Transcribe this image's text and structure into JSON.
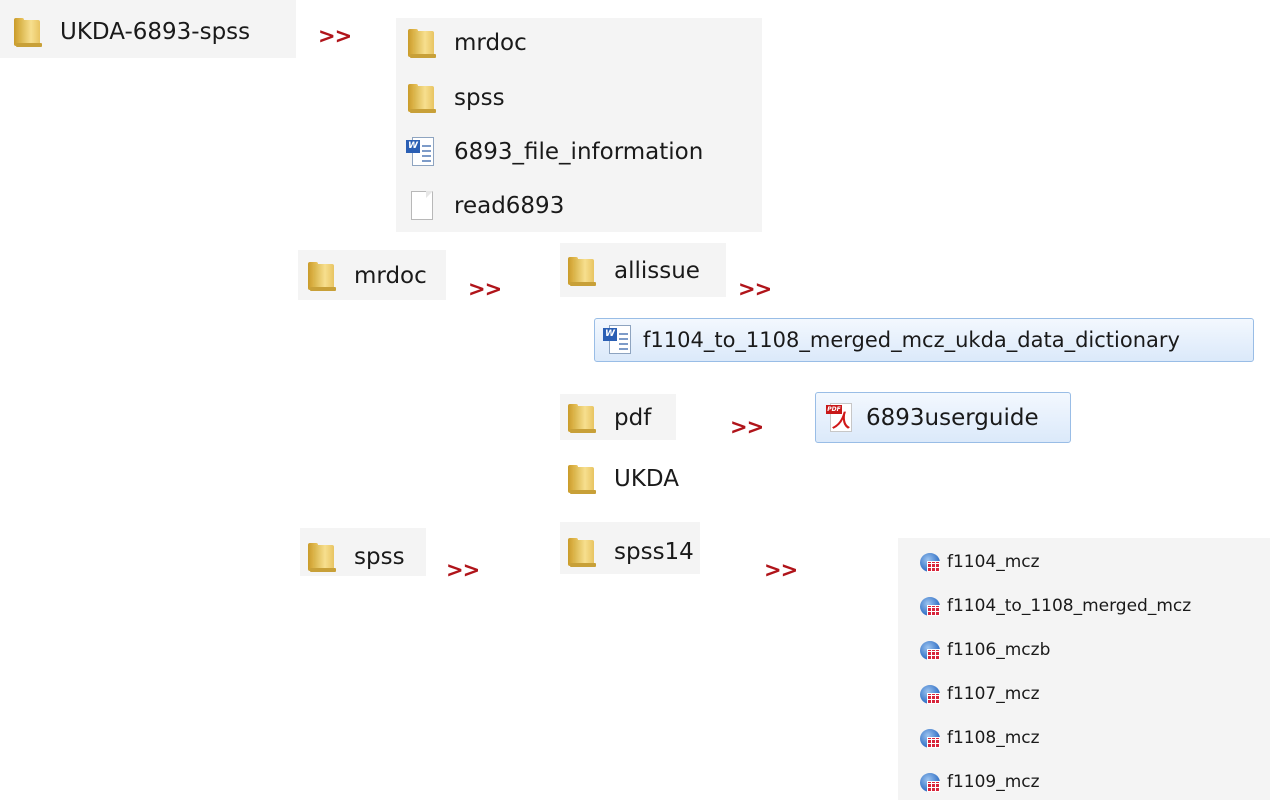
{
  "arrow_text": ">>",
  "root": {
    "name": "UKDA-6893-spss",
    "icon": "folder-icon"
  },
  "root_contents": [
    {
      "name": "mrdoc",
      "icon": "folder-icon"
    },
    {
      "name": "spss",
      "icon": "folder-icon"
    },
    {
      "name": "6893_file_information",
      "icon": "word-document-icon"
    },
    {
      "name": "read6893",
      "icon": "text-file-icon"
    }
  ],
  "mrdoc": {
    "name": "mrdoc",
    "allissue": {
      "name": "allissue"
    },
    "allissue_file": {
      "name": "f1104_to_1108_merged_mcz_ukda_data_dictionary",
      "icon": "word-document-icon"
    },
    "pdf": {
      "name": "pdf"
    },
    "pdf_file": {
      "name": "6893userguide",
      "icon": "pdf-icon"
    },
    "ukda": {
      "name": "UKDA"
    }
  },
  "spss": {
    "name": "spss",
    "spss14": {
      "name": "spss14"
    },
    "files": [
      {
        "name": "f1104_mcz",
        "icon": "spss-data-file-icon"
      },
      {
        "name": "f1104_to_1108_merged_mcz",
        "icon": "spss-data-file-icon"
      },
      {
        "name": "f1106_mczb",
        "icon": "spss-data-file-icon"
      },
      {
        "name": "f1107_mcz",
        "icon": "spss-data-file-icon"
      },
      {
        "name": "f1108_mcz",
        "icon": "spss-data-file-icon"
      },
      {
        "name": "f1109_mcz",
        "icon": "spss-data-file-icon"
      }
    ]
  }
}
